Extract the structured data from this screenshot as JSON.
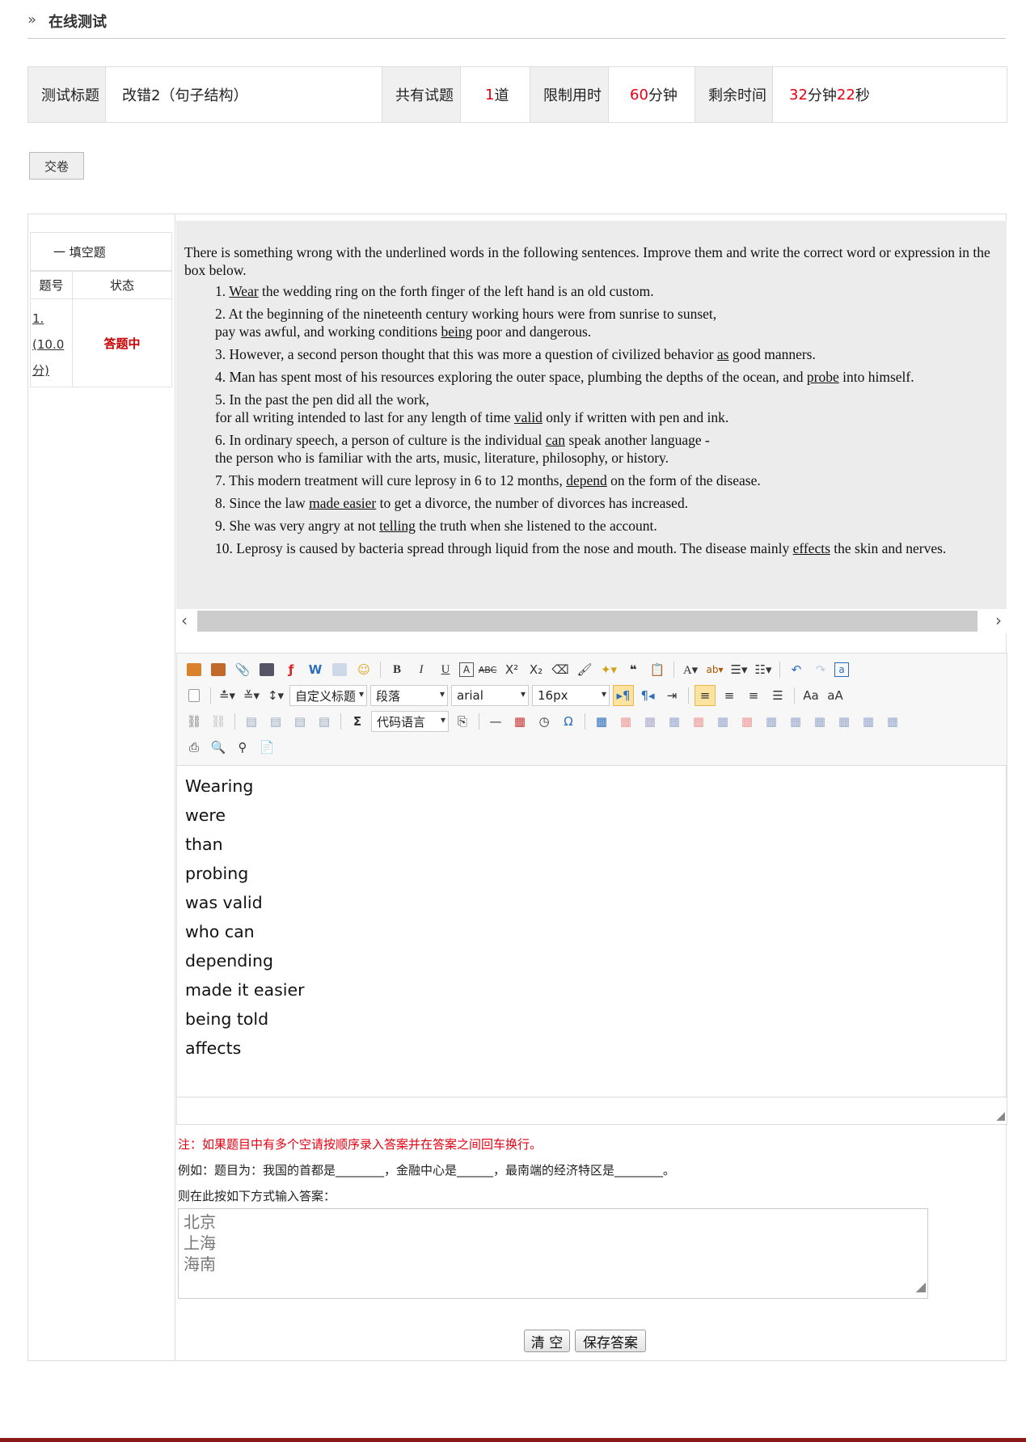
{
  "header": {
    "title": "在线测试"
  },
  "info": {
    "title_label": "测试标题",
    "title_value": "改错2（句子结构）",
    "count_label": "共有试题",
    "count_num": "1",
    "count_unit": "道",
    "limit_label": "限制用时",
    "limit_num": "60",
    "limit_unit": "分钟",
    "remain_label": "剩余时间",
    "remain_min": "32",
    "remain_min_unit": "分钟",
    "remain_sec": "22",
    "remain_sec_unit": "秒"
  },
  "submit_label": "交卷",
  "sidebar": {
    "section": "一 填空题",
    "col_no": "题号",
    "col_status": "状态",
    "q_no": "1.(10.0分)",
    "q_status": "答题中"
  },
  "question": {
    "intro": "There is something wrong with the underlined words in the following sentences. Improve them and write the correct word or expression in the box below.",
    "items": [
      {
        "pre": "1. ",
        "u": "Wear",
        "post": " the wedding ring on the forth finger of the left hand is an old custom."
      },
      {
        "pre": "2. At the beginning of the nineteenth century working hours were from sunrise to sunset,",
        "line2pre": "pay was awful, and working conditions ",
        "u": "being",
        "post": " poor and dangerous."
      },
      {
        "pre": "3. However, a second person thought that this was more a question of civilized behavior ",
        "u": "as",
        "post": " good manners."
      },
      {
        "pre": "4. Man has spent most of his resources exploring the outer space, plumbing the depths of the ocean, and ",
        "u": "probe",
        "post": " into himself."
      },
      {
        "pre": "5. In the past the pen did all the work,",
        "line2pre": "for all writing intended to last for any length of time ",
        "u": "valid",
        "post": " only if written with pen and ink."
      },
      {
        "pre": "6. In ordinary speech, a person of culture is the individual ",
        "u": "can",
        "post": " speak another language -",
        "line2pre": "the person who is familiar with the arts, music, literature, philosophy, or history."
      },
      {
        "pre": "7. This modern treatment will cure leprosy in 6 to 12 months, ",
        "u": "depend",
        "post": " on the form of the disease."
      },
      {
        "pre": "8. Since the law ",
        "u": "made easier",
        "post": " to get a divorce, the number of divorces has increased."
      },
      {
        "pre": "9. She was very angry at not ",
        "u": "telling",
        "post": " the truth when she listened to the account."
      },
      {
        "pre": "10. Leprosy is caused by bacteria spread through liquid from the nose and mouth. The disease mainly ",
        "u": "effects",
        "post": " the skin and nerves."
      }
    ]
  },
  "toolbar": {
    "heading_select": "自定义标题",
    "paragraph_select": "段落",
    "font_select": "arial",
    "size_select": "16px",
    "code_select": "代码语言"
  },
  "answers": [
    "Wearing",
    "were",
    "than",
    "probing",
    "was valid",
    "who can",
    "depending",
    "made it easier",
    "being told",
    "affects"
  ],
  "notes": {
    "note1": "注：如果题目中有多个空请按顺序录入答案并在答案之间回车换行。",
    "note2": "例如：题目为：我国的首都是________，金融中心是______，最南端的经济特区是________。",
    "note3": "则在此按如下方式输入答案：",
    "example_lines": [
      "北京",
      "上海",
      "海南"
    ]
  },
  "buttons": {
    "clear": "清 空",
    "save": "保存答案"
  },
  "colors": {
    "accent_red": "#e60012",
    "bottom_bar": "#8b1a1a",
    "status_red": "#cc0000"
  }
}
